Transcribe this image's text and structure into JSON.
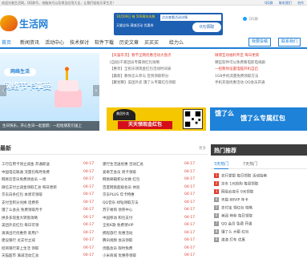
{
  "topbar": {
    "left_text": "欢迎光临生活网，QQ群号，电脑技巧以及常见应用大全，让我们轻松乐享生活！",
    "links": [
      "QQ群",
      "联系我们",
      "合作"
    ]
  },
  "header": {
    "logo_text": "生活网",
    "banner": {
      "date": "10月09日 每 500周年庆典",
      "link_text": "点击查看活动详情",
      "sub": "天猫全场 满减活动 优惠券",
      "button": "0元领取"
    },
    "qq_label": "QQ群"
  },
  "nav": {
    "items": [
      "首页",
      "新闻资讯",
      "活动中心",
      "技术探讨",
      "软件下载",
      "历史文章",
      "买买买",
      "给力么"
    ],
    "active_index": 0,
    "buttons": [
      "我要投稿",
      "联系我们"
    ]
  },
  "slider": {
    "pill": "网络生活",
    "headline": "网络节卡享受",
    "caption": "生日快乐，开心生日一起蛋糕：一起给朋友们送上",
    "prev": "‹",
    "next": "›"
  },
  "news_mid": [
    "【天猫年货】春节全网优惠活动大盘点",
    "[自助]千家团员专属领红包攻略",
    "【惠享】全民乐领现金红包活动时间表",
    "【最新】教你怎么参与 签到领取积分",
    "【聚划算】美团外卖 饿了么专属红包领取"
  ],
  "news_right": [
    "微博互动福利专区 每日更新",
    "哪些软件可以免费看电影电视剧",
    "一招教你设置电脑开机自启",
    "1GB手机流量免费领取方法",
    "手机充值优惠活动 QQ会员开通"
  ],
  "ads": {
    "left_brand": "美团外卖",
    "left_text": "天天领现金红包",
    "right_logo": "饿了么",
    "right_text": "饿了么专属红包"
  },
  "latest": {
    "title": "最新",
    "more": "更多",
    "left_rows": [
      "工行信用卡领立减金 开通即送",
      "中国电信联通 流量包每月免费",
      "网易云音乐免费领会员 一周",
      "微信支付立减金领取汇总 每日更新",
      "京东白条红包 本周可领取",
      "支付宝积分兑换 话费券",
      "饿了么会员 免费领取月卡",
      "拼多多现金大转盘攻略",
      "美团外卖红包 每日可领",
      "滴滴出行优惠券 新用户",
      "建设银行 龙支付立减",
      "招商银行掌上生活 领取",
      "天猫超市 满减活动汇总"
    ],
    "dates_left": [
      "04-17",
      "04-17",
      "04-17",
      "04-17",
      "04-17",
      "04-17",
      "04-17",
      "04-17",
      "04-17",
      "04-17",
      "04-17",
      "04-17",
      "04-17"
    ],
    "right_rows": [
      "建行生活送优惠 活动汇总",
      "爱奇艺会员 周卡领取",
      "网易邮箱积分兑换 红包",
      "百度网盘超级会员 体验",
      "京东PLUS 年卡特惠",
      "QQ音乐 绿钻领取方法",
      "苏宁易购 领券中心",
      "中国移动 和包支付",
      "全民K歌 免费领VIP",
      "携程旅行 优惠活动",
      "腾讯视频 会员领取",
      "优酷会员 限时免费",
      "小米商城 优惠券领取"
    ],
    "dates_right": [
      "04-17",
      "04-17",
      "04-17",
      "04-17",
      "04-17",
      "04-17",
      "04-17",
      "04-17",
      "04-17",
      "04-17",
      "04-17",
      "04-17",
      "04-17"
    ]
  },
  "hot": {
    "title": "热门推荐",
    "tabs": [
      "3天热门",
      "7天热门"
    ],
    "items": [
      "农行掌银 每日领取 活动指南",
      "京东 1元抢购 每周领取",
      "网易云音乐 0元领取",
      "天猫 88VIP 年卡",
      "支付宝 领红包 攻略",
      "美团 神券 每日领取",
      "QQ 会员 免费 开通",
      "饿了么 大额 红包",
      "滴滴 打车 优惠"
    ]
  },
  "colors": {
    "accent": "#1f7fd6",
    "hot": "#e03c2e",
    "banner": "#1d5fb1",
    "ad_yellow": "#f5c700",
    "ad_blue": "#1d82d8"
  }
}
